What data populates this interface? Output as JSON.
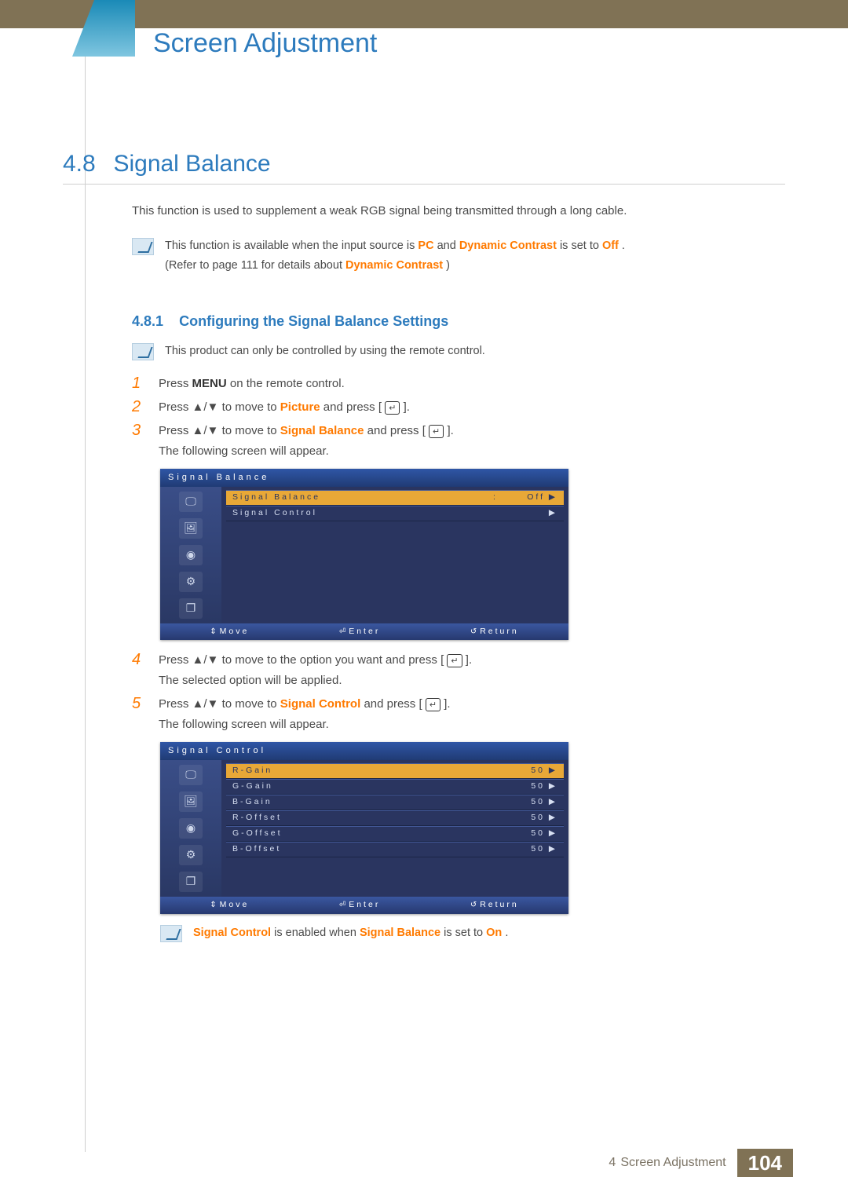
{
  "chapter": {
    "title": "Screen Adjustment",
    "number": "4"
  },
  "section": {
    "number": "4.8",
    "title": "Signal Balance"
  },
  "intro": "This function is used to supplement a weak RGB signal being transmitted through a long cable.",
  "note1": {
    "line1a": "This function is available when the input source is ",
    "pc": "PC",
    "line1b": " and ",
    "dc": "Dynamic Contrast",
    "line1c": " is set to ",
    "off": "Off",
    "line1d": ".",
    "line2a": "(Refer to page 111 for details about ",
    "dc2": "Dynamic Contrast",
    "line2b": ")"
  },
  "subsection": {
    "number": "4.8.1",
    "title": "Configuring the Signal Balance Settings"
  },
  "note2": "This product can only be controlled by using the remote control.",
  "steps": {
    "s1": {
      "n": "1",
      "a": "Press ",
      "menu": "MENU",
      "b": " on the remote control."
    },
    "s2": {
      "n": "2",
      "a": "Press ",
      "arrows": "▲/▼",
      "b": " to move to ",
      "t": "Picture",
      "c": " and press [",
      "d": "]."
    },
    "s3": {
      "n": "3",
      "a": "Press ",
      "arrows": "▲/▼",
      "b": " to move to ",
      "t": "Signal Balance",
      "c": " and press [",
      "d": "].",
      "cont": "The following screen will appear."
    },
    "s4": {
      "n": "4",
      "a": "Press ",
      "arrows": "▲/▼",
      "b": " to move to the option you want and press [",
      "c": "].",
      "cont": "The selected option will be applied."
    },
    "s5": {
      "n": "5",
      "a": "Press ",
      "arrows": "▲/▼",
      "b": " to move to ",
      "t": "Signal Control",
      "c": " and press [",
      "d": "].",
      "cont": "The following screen will appear."
    }
  },
  "osd1": {
    "title": "Signal Balance",
    "rows": [
      {
        "label": "Signal Balance",
        "value": "Off",
        "sel": true,
        "colon": ":"
      },
      {
        "label": "Signal Control",
        "value": "",
        "sel": false,
        "colon": ""
      }
    ],
    "foot": {
      "move": "Move",
      "enter": "Enter",
      "return": "Return"
    }
  },
  "osd2": {
    "title": "Signal Control",
    "rows": [
      {
        "label": "R-Gain",
        "value": "50",
        "sel": true
      },
      {
        "label": "G-Gain",
        "value": "50",
        "sel": false
      },
      {
        "label": "B-Gain",
        "value": "50",
        "sel": false
      },
      {
        "label": "R-Offset",
        "value": "50",
        "sel": false
      },
      {
        "label": "G-Offset",
        "value": "50",
        "sel": false
      },
      {
        "label": "B-Offset",
        "value": "50",
        "sel": false
      }
    ],
    "foot": {
      "move": "Move",
      "enter": "Enter",
      "return": "Return"
    }
  },
  "note3": {
    "a": "Signal Control",
    "b": " is enabled when ",
    "c": "Signal Balance",
    "d": " is set to ",
    "e": "On",
    "f": "."
  },
  "footer": {
    "chapnum": "4",
    "label": "Screen Adjustment",
    "page": "104"
  }
}
